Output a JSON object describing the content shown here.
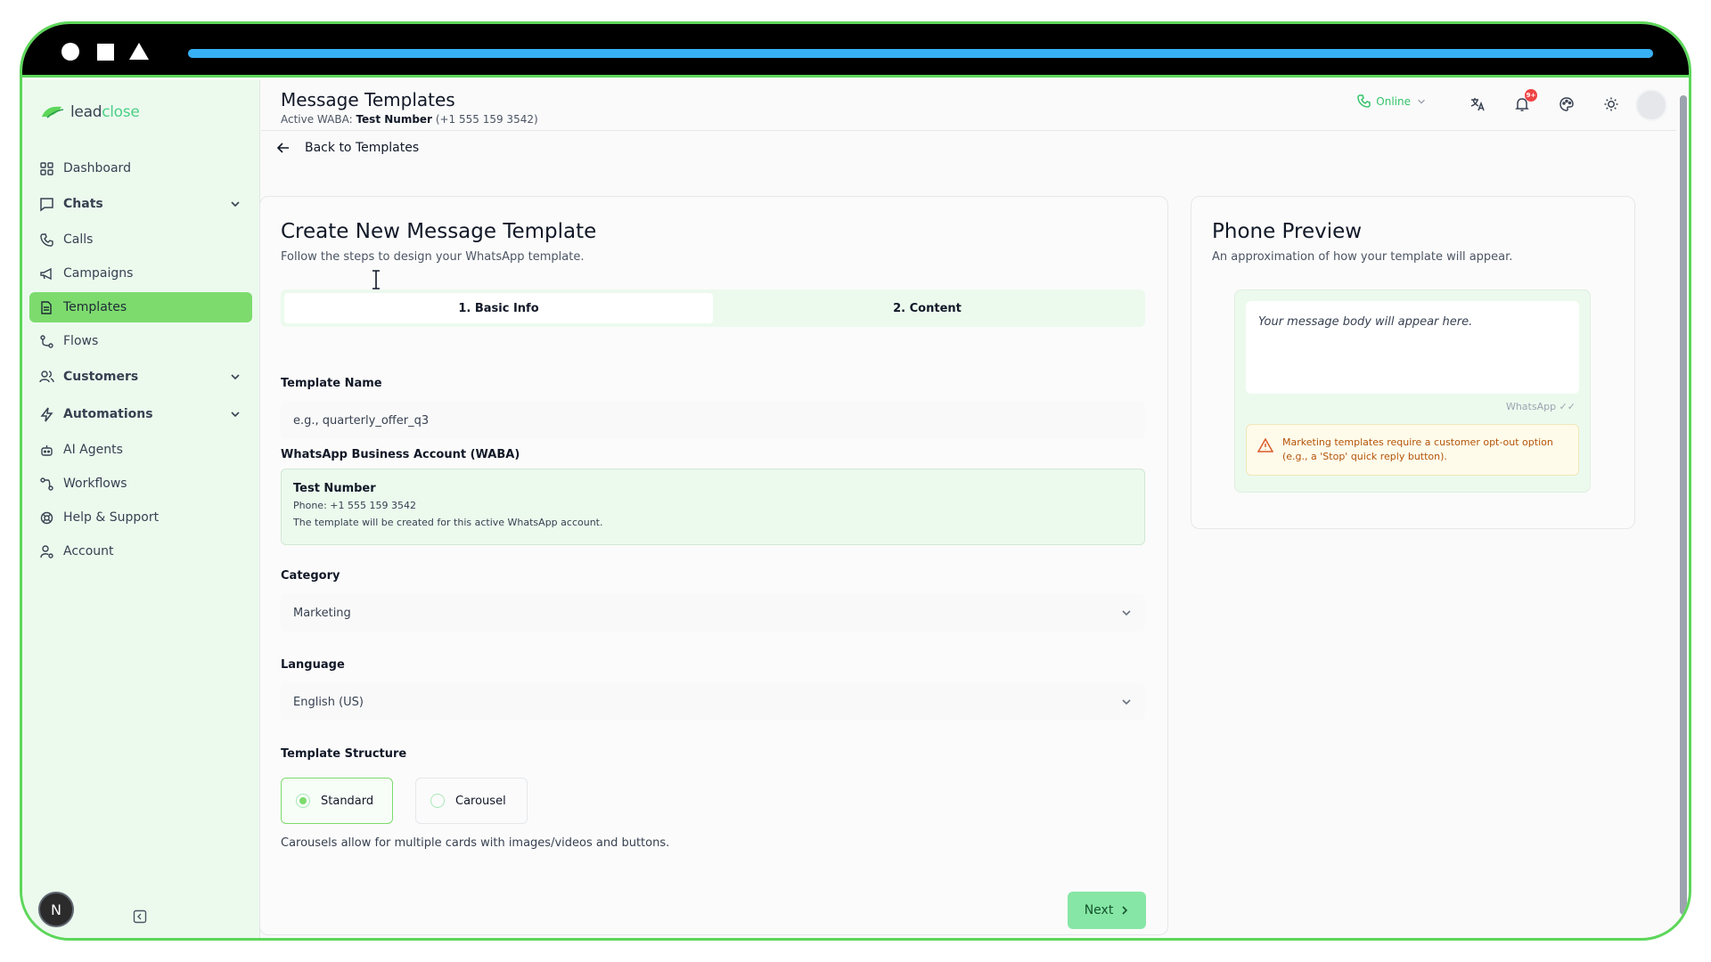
{
  "brand": {
    "logo_prefix": "lead",
    "logo_accent": "close",
    "accent_color": "#7ddb6e"
  },
  "sidebar": {
    "items": [
      {
        "label": "Dashboard",
        "icon": "grid-icon"
      },
      {
        "label": "Chats",
        "icon": "chat-icon"
      },
      {
        "label": "Calls",
        "icon": "phone-icon"
      },
      {
        "label": "Campaigns",
        "icon": "megaphone-icon"
      },
      {
        "label": "Templates",
        "icon": "document-icon"
      },
      {
        "label": "Flows",
        "icon": "flow-icon"
      },
      {
        "label": "Customers",
        "icon": "users-icon"
      },
      {
        "label": "Automations",
        "icon": "bolt-icon"
      },
      {
        "label": "AI Agents",
        "icon": "robot-icon"
      },
      {
        "label": "Workflows",
        "icon": "workflow-icon"
      },
      {
        "label": "Help & Support",
        "icon": "lifebuoy-icon"
      },
      {
        "label": "Account",
        "icon": "user-cog-icon"
      }
    ],
    "user_initial": "N"
  },
  "header": {
    "title": "Message Templates",
    "sub_prefix": "Active WABA:",
    "sub_name": "Test Number",
    "sub_phone": "(+1 555 159 3542)",
    "status": "Online",
    "notification_badge": "9+"
  },
  "back_label": "Back to Templates",
  "form": {
    "title": "Create New Message Template",
    "subtitle": "Follow the steps to design your WhatsApp template.",
    "tabs": [
      "1. Basic Info",
      "2. Content"
    ],
    "template_name": {
      "label": "Template Name",
      "placeholder": "e.g., quarterly_offer_q3"
    },
    "waba": {
      "label": "WhatsApp Business Account (WABA)",
      "name": "Test Number",
      "phone": "Phone: +1 555 159 3542",
      "note": "The template will be created for this active WhatsApp account."
    },
    "category": {
      "label": "Category",
      "value": "Marketing"
    },
    "language": {
      "label": "Language",
      "value": "English (US)"
    },
    "structure": {
      "label": "Template Structure",
      "options": [
        "Standard",
        "Carousel"
      ],
      "helper": "Carousels allow for multiple cards with images/videos and buttons."
    },
    "next_label": "Next"
  },
  "preview": {
    "title": "Phone Preview",
    "subtitle": "An approximation of how your template will appear.",
    "body": "Your message body will appear here.",
    "meta": "WhatsApp ✓✓",
    "warning": "Marketing templates require a customer opt-out option (e.g., a 'Stop' quick reply button)."
  },
  "topbar": {
    "progress_percent": 100
  }
}
